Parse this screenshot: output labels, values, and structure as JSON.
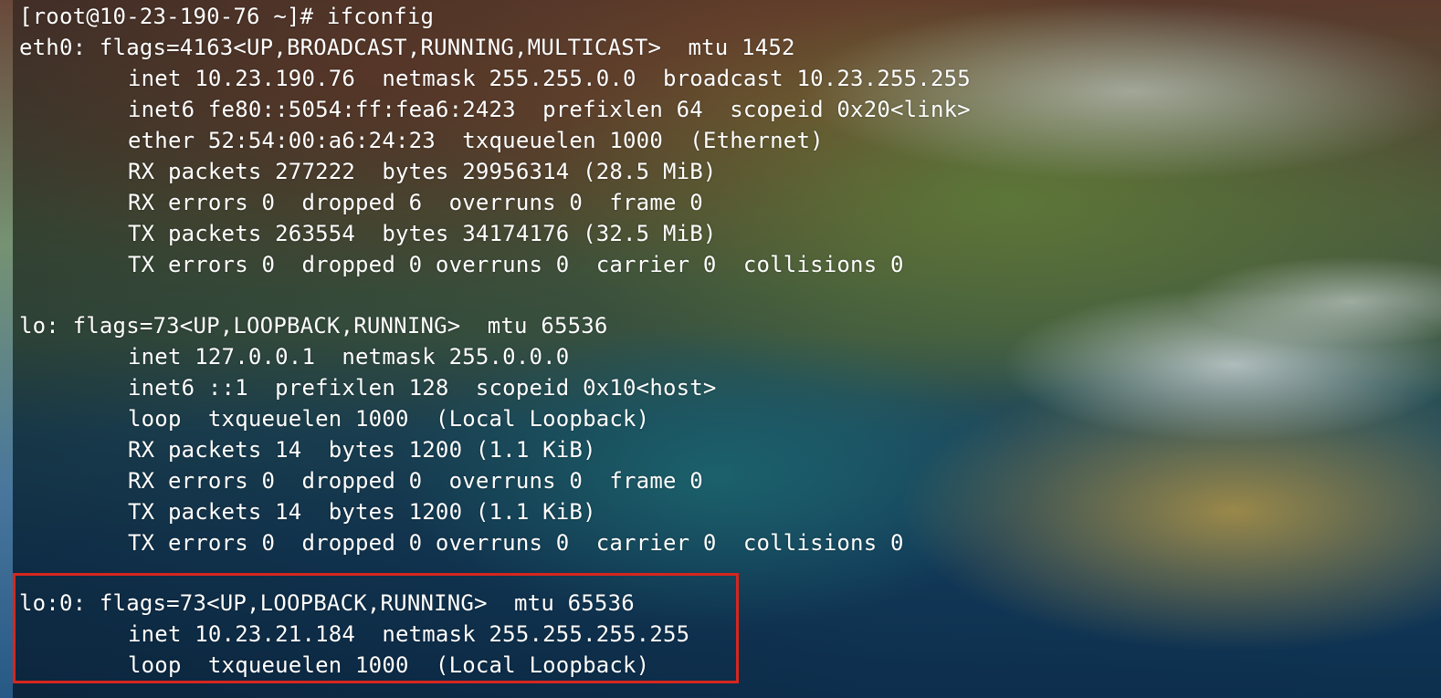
{
  "terminal": {
    "prompt": "[root@10-23-190-76 ~]# ifconfig",
    "eth0": {
      "header": "eth0: flags=4163<UP,BROADCAST,RUNNING,MULTICAST>  mtu 1452",
      "lines": [
        "inet 10.23.190.76  netmask 255.255.0.0  broadcast 10.23.255.255",
        "inet6 fe80::5054:ff:fea6:2423  prefixlen 64  scopeid 0x20<link>",
        "ether 52:54:00:a6:24:23  txqueuelen 1000  (Ethernet)",
        "RX packets 277222  bytes 29956314 (28.5 MiB)",
        "RX errors 0  dropped 6  overruns 0  frame 0",
        "TX packets 263554  bytes 34174176 (32.5 MiB)",
        "TX errors 0  dropped 0 overruns 0  carrier 0  collisions 0"
      ]
    },
    "lo": {
      "header": "lo: flags=73<UP,LOOPBACK,RUNNING>  mtu 65536",
      "lines": [
        "inet 127.0.0.1  netmask 255.0.0.0",
        "inet6 ::1  prefixlen 128  scopeid 0x10<host>",
        "loop  txqueuelen 1000  (Local Loopback)",
        "RX packets 14  bytes 1200 (1.1 KiB)",
        "RX errors 0  dropped 0  overruns 0  frame 0",
        "TX packets 14  bytes 1200 (1.1 KiB)",
        "TX errors 0  dropped 0 overruns 0  carrier 0  collisions 0"
      ]
    },
    "lo0": {
      "header": "lo:0: flags=73<UP,LOOPBACK,RUNNING>  mtu 65536",
      "lines": [
        "inet 10.23.21.184  netmask 255.255.255.255",
        "loop  txqueuelen 1000  (Local Loopback)"
      ]
    }
  },
  "colors": {
    "text": "#ffffff",
    "highlight_border": "#d7261e"
  }
}
